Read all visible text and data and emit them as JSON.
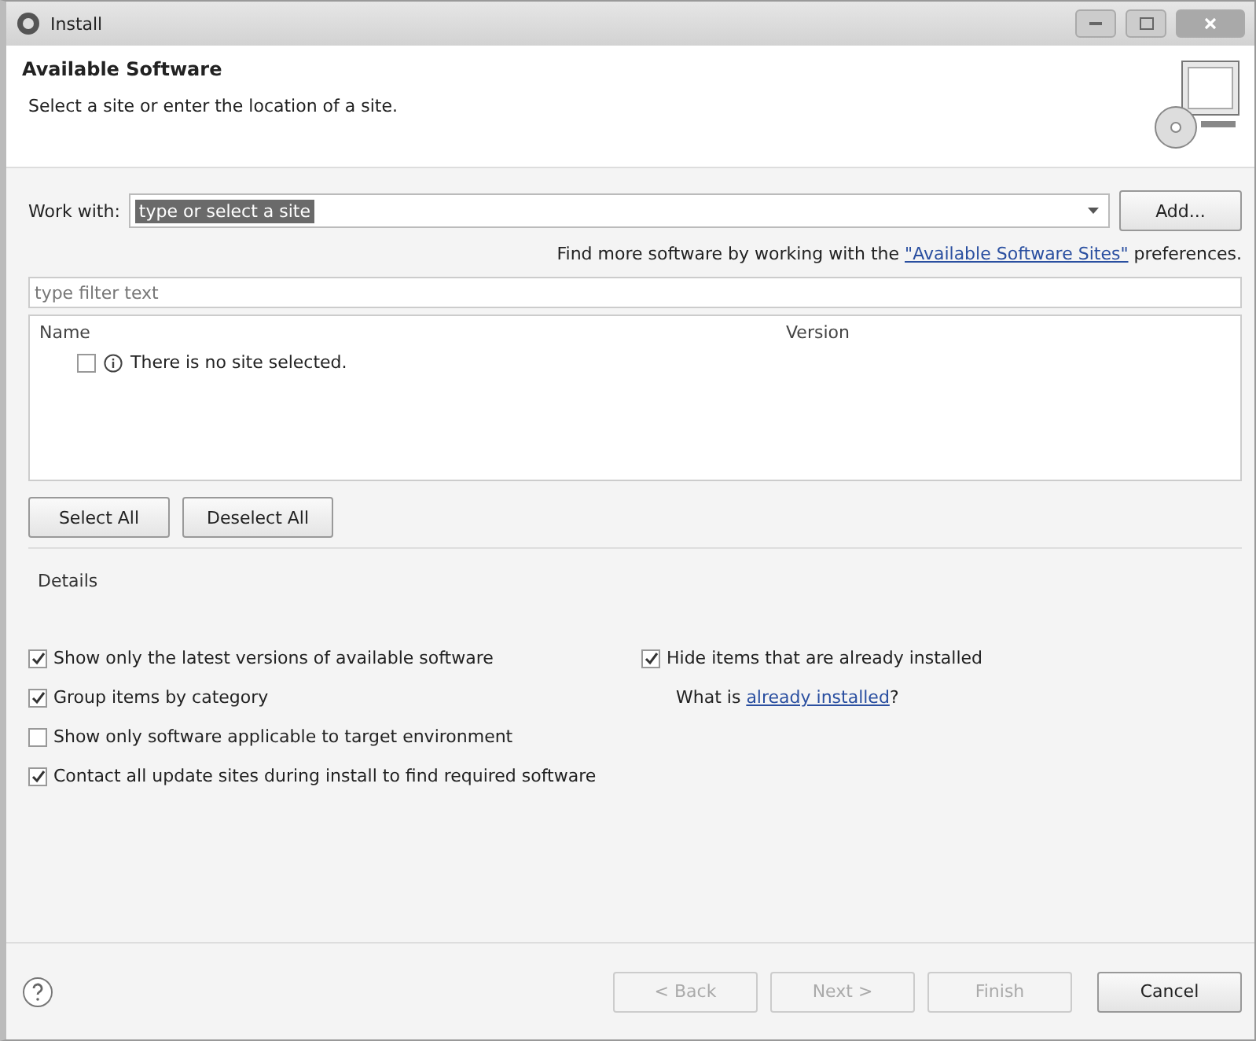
{
  "window": {
    "title": "Install"
  },
  "header": {
    "title": "Available Software",
    "subtitle": "Select a site or enter the location of a site."
  },
  "work_with": {
    "label": "Work with:",
    "value": "type or select a site",
    "add_button": "Add..."
  },
  "more_software": {
    "prefix": "Find more software by working with the ",
    "link": "\"Available Software Sites\"",
    "suffix": " preferences."
  },
  "filter": {
    "placeholder": "type filter text"
  },
  "table": {
    "columns": [
      "Name",
      "Version"
    ],
    "rows": [
      {
        "name": "There is no site selected.",
        "checked": false
      }
    ]
  },
  "selection_buttons": [
    "Select All",
    "Deselect All"
  ],
  "details": {
    "label": "Details"
  },
  "options_left": [
    {
      "label": "Show only the latest versions of available software",
      "checked": true
    },
    {
      "label": "Group items by category",
      "checked": true
    },
    {
      "label": "Show only software applicable to target environment",
      "checked": false
    },
    {
      "label": "Contact all update sites during install to find required software",
      "checked": true
    }
  ],
  "options_right": [
    {
      "kind": "checkbox",
      "label": "Hide items that are already installed",
      "checked": true
    },
    {
      "kind": "link_text",
      "prefix": "What is ",
      "link": "already installed",
      "suffix": "?"
    }
  ],
  "footer_buttons": [
    {
      "label": "< Back",
      "disabled": true
    },
    {
      "label": "Next >",
      "disabled": true
    },
    {
      "label": "Finish",
      "disabled": true
    },
    {
      "label": "Cancel",
      "disabled": false
    }
  ]
}
